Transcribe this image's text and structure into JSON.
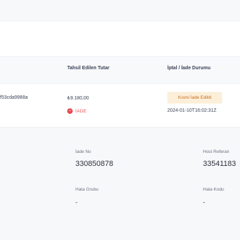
{
  "columns": {
    "collected_amount": "Tahsil Edilen Tutar",
    "cancel_refund_status": "İptal / İade Durumu"
  },
  "row": {
    "id_fragment": "f53cda9988a",
    "amount": "₺9.180,00",
    "refund_badge": "Kısmi İade Edildi",
    "status": {
      "icon": "minus-circle-icon",
      "icon_glyph": "−",
      "label": "İADE"
    },
    "timestamp": "2024-01-10T16:02:31Z"
  },
  "details": {
    "refund_no_label": "İade No",
    "refund_no_value": "330850878",
    "host_ref_label": "Host Referan",
    "host_ref_value": "33541183",
    "error_group_label": "Hata Grubu",
    "error_group_value": "-",
    "error_code_label": "Hata Kodu",
    "error_code_value": "-"
  },
  "colors": {
    "badge_bg": "#fcefd9",
    "badge_text": "#c56a1e",
    "status_red": "#e5484d"
  }
}
